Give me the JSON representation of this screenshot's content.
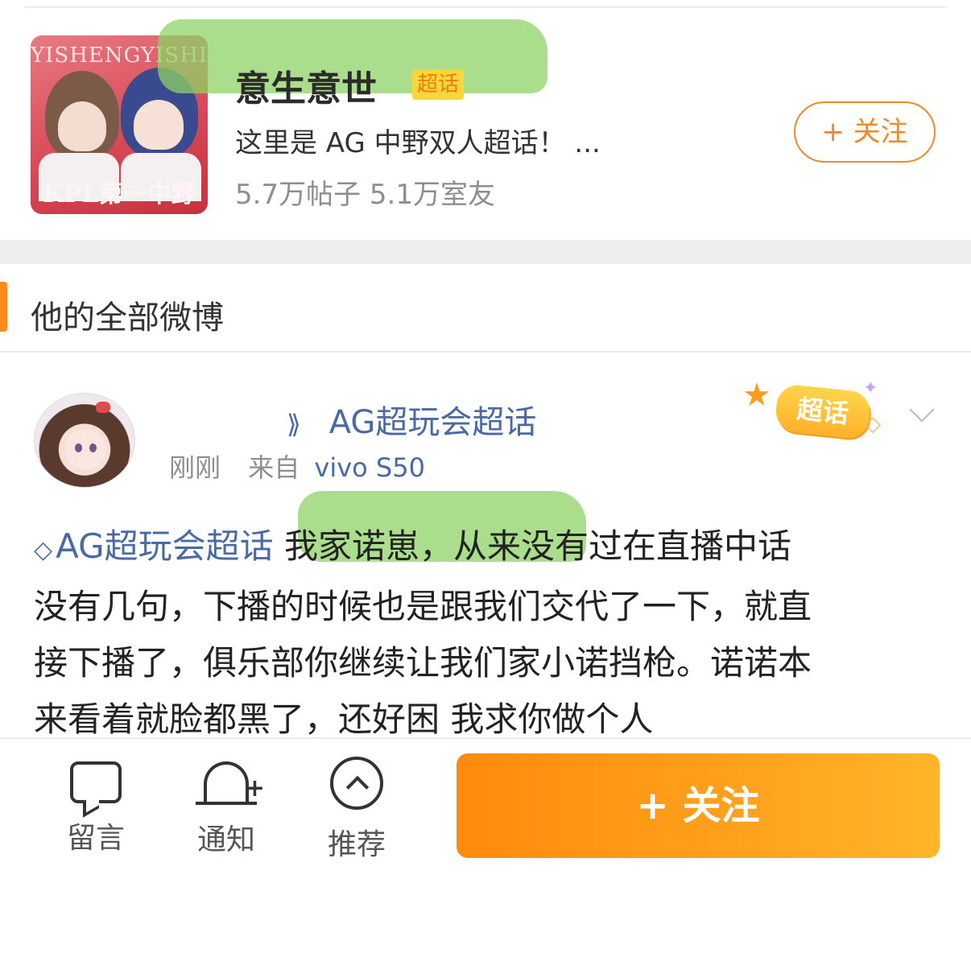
{
  "supertopic": {
    "cover_title": "YISHENGYISHI",
    "cover_caption": "KPL第一中野",
    "name": "意生意世",
    "badge": "超话",
    "description": "这里是 AG 中野双人超话！ ...",
    "stats": "5.7万帖子 5.1万室友",
    "follow_label": "+ 关注"
  },
  "section": {
    "title": "他的全部微博"
  },
  "post": {
    "topic": "AG超玩会超话",
    "time": "刚刚",
    "source_prefix": "来自",
    "device": "vivo S50",
    "sticker_label": "超话",
    "body_topic": "AG超玩会超话",
    "body_lines": [
      " 我家诺崽，从来没有过在直播中话",
      "没有几句，下播的时候也是跟我们交代了一下，就直",
      "接下播了，俱乐部你继续让我们家小诺挡枪。诺诺本",
      "来看着就脸都黑了，还好困 我求你做个人"
    ]
  },
  "action_bar": {
    "comment_label": "留言",
    "notify_label": "通知",
    "recommend_label": "推荐",
    "follow_label": "+ 关注"
  },
  "icons": [
    "tag-icon",
    "gem-icon",
    "chevron-down-icon",
    "comment-icon",
    "bell-plus-icon",
    "arrow-up-circle-icon"
  ],
  "colors": {
    "accent_orange": "#ff8a1e",
    "link_blue": "#4a6aa5",
    "highlight_green": "#8ed166"
  }
}
